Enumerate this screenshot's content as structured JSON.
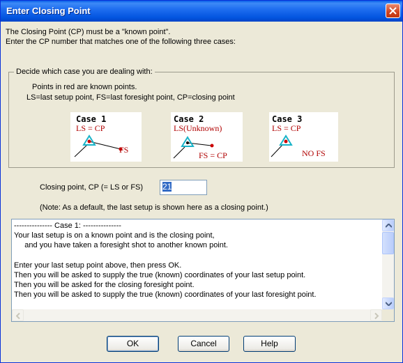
{
  "window": {
    "title": "Enter Closing Point"
  },
  "intro": {
    "line1": "The Closing Point (CP) must be a \"known point\".",
    "line2": "Enter the CP number that matches one of the following three cases:"
  },
  "group": {
    "legend": "Decide which case you are dealing with:",
    "line1": "Points in red are known points.",
    "line2": "LS=last setup point, FS=last foresight point, CP=closing point"
  },
  "cases": [
    {
      "title": "Case 1",
      "subtitle": "LS = CP",
      "label": "FS"
    },
    {
      "title": "Case 2",
      "subtitle": "LS(Unknown)",
      "label": "FS = CP"
    },
    {
      "title": "Case 3",
      "subtitle": "LS = CP",
      "label": "NO FS"
    }
  ],
  "closing_point": {
    "label": "Closing point, CP (= LS or FS)",
    "value": "21",
    "note": "(Note: As a default, the last setup is shown here as a closing point.)"
  },
  "help_text": {
    "lines": [
      "--------------- Case 1: ---------------",
      "Your last setup is on a known point and is the closing point,",
      "     and you have taken a foresight shot to another known point.",
      "",
      "Enter your last setup point above, then press OK.",
      "Then you will be asked to supply the true (known) coordinates of your last setup point.",
      "Then you will be asked for the closing foresight point.",
      "Then you will be asked to supply the true (known) coordinates of your last foresight point."
    ]
  },
  "buttons": {
    "ok": "OK",
    "cancel": "Cancel",
    "help": "Help"
  },
  "colors": {
    "known_point": "#b00000",
    "setup_marker": "#19b3c8",
    "titlebar": "#0a5fe8"
  }
}
